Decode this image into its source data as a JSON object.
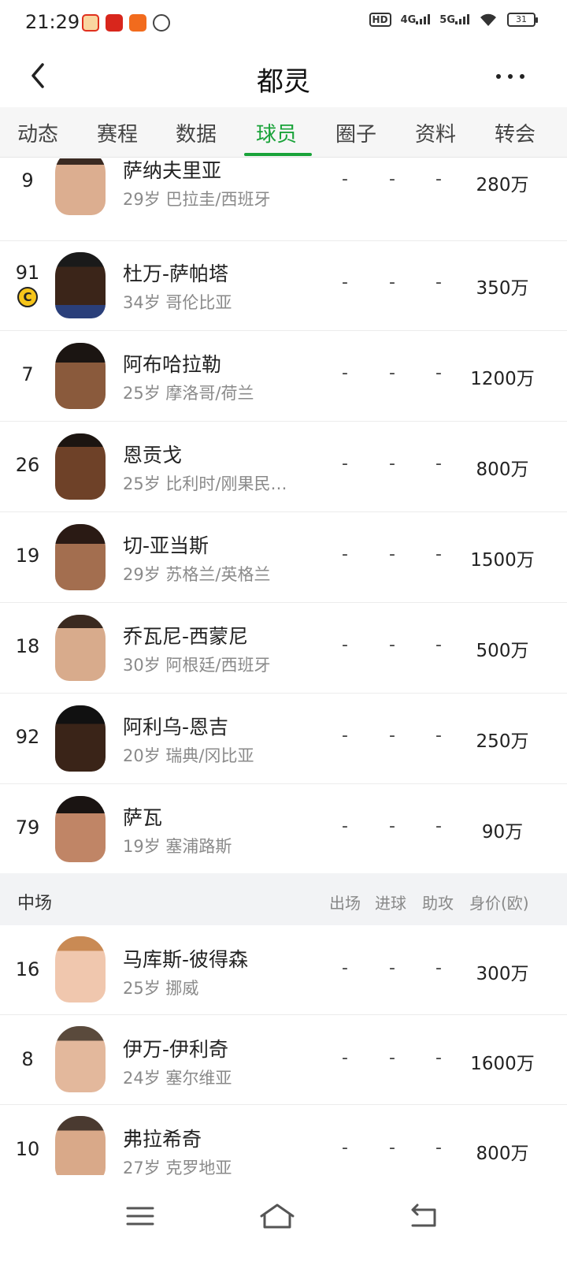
{
  "status": {
    "time": "21:29",
    "hd": "HD",
    "net1": "4G",
    "net2": "5G",
    "battery": "31"
  },
  "header": {
    "title": "都灵"
  },
  "tabs": [
    {
      "label": "动态"
    },
    {
      "label": "赛程"
    },
    {
      "label": "数据"
    },
    {
      "label": "球员",
      "active": true
    },
    {
      "label": "圈子"
    },
    {
      "label": "资料"
    },
    {
      "label": "转会"
    }
  ],
  "forwards": [
    {
      "number": "9",
      "name": "萨纳夫里亚",
      "meta": "29岁 巴拉圭/西班牙",
      "apps": "-",
      "goals": "-",
      "assists": "-",
      "value": "280万"
    },
    {
      "number": "91",
      "name": "杜万-萨帕塔",
      "meta": "34岁 哥伦比亚",
      "apps": "-",
      "goals": "-",
      "assists": "-",
      "value": "350万",
      "captain": "C"
    },
    {
      "number": "7",
      "name": "阿布哈拉勒",
      "meta": "25岁 摩洛哥/荷兰",
      "apps": "-",
      "goals": "-",
      "assists": "-",
      "value": "1200万"
    },
    {
      "number": "26",
      "name": "恩贡戈",
      "meta": "25岁 比利时/刚果民…",
      "apps": "-",
      "goals": "-",
      "assists": "-",
      "value": "800万"
    },
    {
      "number": "19",
      "name": "切-亚当斯",
      "meta": "29岁 苏格兰/英格兰",
      "apps": "-",
      "goals": "-",
      "assists": "-",
      "value": "1500万"
    },
    {
      "number": "18",
      "name": "乔瓦尼-西蒙尼",
      "meta": "30岁 阿根廷/西班牙",
      "apps": "-",
      "goals": "-",
      "assists": "-",
      "value": "500万"
    },
    {
      "number": "92",
      "name": "阿利乌-恩吉",
      "meta": "20岁 瑞典/冈比亚",
      "apps": "-",
      "goals": "-",
      "assists": "-",
      "value": "250万"
    },
    {
      "number": "79",
      "name": "萨瓦",
      "meta": "19岁 塞浦路斯",
      "apps": "-",
      "goals": "-",
      "assists": "-",
      "value": "90万"
    }
  ],
  "midfield_header": {
    "title": "中场",
    "col_apps": "出场",
    "col_goals": "进球",
    "col_assists": "助攻",
    "col_value": "身价(欧)"
  },
  "midfielders": [
    {
      "number": "16",
      "name": "马库斯-彼得森",
      "meta": "25岁 挪威",
      "apps": "-",
      "goals": "-",
      "assists": "-",
      "value": "300万"
    },
    {
      "number": "8",
      "name": "伊万-伊利奇",
      "meta": "24岁 塞尔维亚",
      "apps": "-",
      "goals": "-",
      "assists": "-",
      "value": "1600万"
    },
    {
      "number": "10",
      "name": "弗拉希奇",
      "meta": "27岁 克罗地亚",
      "apps": "-",
      "goals": "-",
      "assists": "-",
      "value": "800万"
    }
  ],
  "colors": {
    "accent": "#1aa33a",
    "captain": "#f6c51a"
  },
  "nav": {
    "menu_icon": "menu-icon",
    "home_icon": "home-icon",
    "back_icon": "return-icon"
  }
}
